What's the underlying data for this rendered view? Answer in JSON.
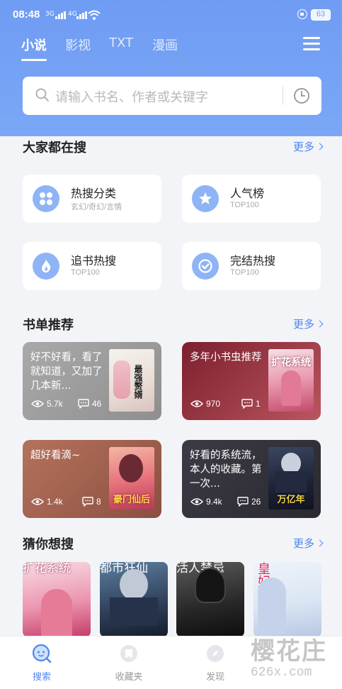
{
  "status_bar": {
    "time": "08:48",
    "signal1": "3G",
    "signal2": "4G",
    "battery": "63"
  },
  "header": {
    "tabs": [
      {
        "label": "小说",
        "active": true
      },
      {
        "label": "影视",
        "active": false
      },
      {
        "label": "TXT",
        "active": false
      },
      {
        "label": "漫画",
        "active": false
      }
    ],
    "search_placeholder": "请输入书名、作者或关键字"
  },
  "hot_search": {
    "title": "大家都在搜",
    "more": "更多",
    "cards": [
      {
        "title": "热搜分类",
        "subtitle": "玄幻/奇幻/言情",
        "icon": "grid-icon"
      },
      {
        "title": "人气榜",
        "subtitle": "TOP100",
        "icon": "star-icon"
      },
      {
        "title": "追书热搜",
        "subtitle": "TOP100",
        "icon": "flame-icon"
      },
      {
        "title": "完结热搜",
        "subtitle": "TOP100",
        "icon": "check-icon"
      }
    ]
  },
  "booklists": {
    "title": "书单推荐",
    "more": "更多",
    "items": [
      {
        "title": "好不好看，看了就知道，又加了几本新...",
        "views": "5.7k",
        "comments": "46",
        "cover_text": "最强赘婿",
        "bg": "#9c9c9c"
      },
      {
        "title": "多年小书虫推荐",
        "views": "970",
        "comments": "1",
        "cover_text": "扩花系统",
        "bg": "#8a2a3a"
      },
      {
        "title": "超好看滴~",
        "views": "1.4k",
        "comments": "8",
        "cover_text": "豪门仙后",
        "bg": "#a0604c"
      },
      {
        "title": "好看的系统流，本人的收藏。第一次...",
        "views": "9.4k",
        "comments": "26",
        "cover_text": "万亿年",
        "bg": "#34333c"
      }
    ]
  },
  "guess": {
    "title": "猜你想搜",
    "more": "更多",
    "covers": [
      "扩花系统",
      "都市狂仙",
      "活人禁忌",
      "皇妃不好惹"
    ]
  },
  "bottom_nav": [
    {
      "label": "搜索",
      "icon": "search-face-icon",
      "active": true
    },
    {
      "label": "收藏夹",
      "icon": "bookmark-icon",
      "active": false
    },
    {
      "label": "发现",
      "icon": "compass-icon",
      "active": false
    }
  ],
  "watermark": {
    "line1": "樱花庄",
    "line2": "626x.com"
  },
  "colors": {
    "accent": "#4f86ee",
    "header": "#7ba7f6",
    "icon_circle": "#8fb4f6"
  }
}
